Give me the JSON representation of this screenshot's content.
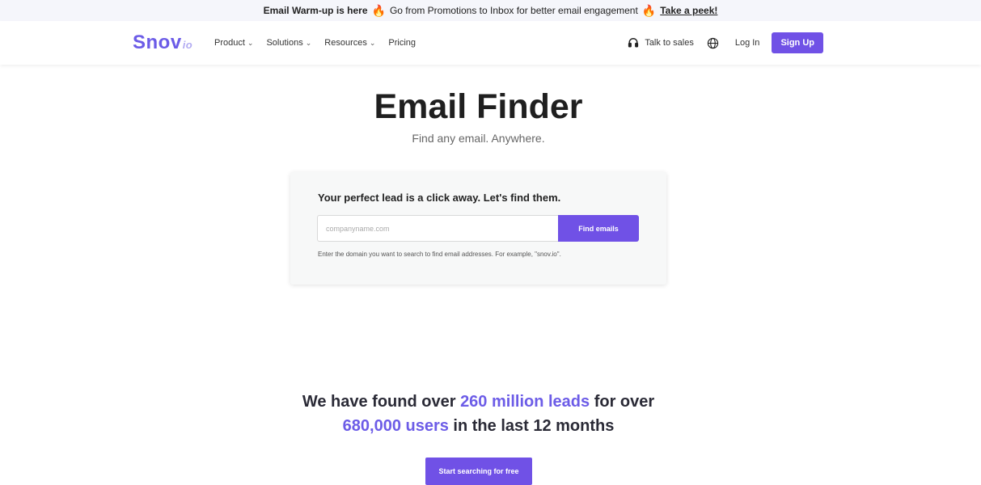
{
  "promo": {
    "headline": "Email Warm-up is here",
    "message": "Go from Promotions to Inbox for better email engagement",
    "link": "Take a peek!",
    "fire_icon": "🔥"
  },
  "nav": {
    "logo_main": "Snov",
    "logo_suffix": "io",
    "items": [
      {
        "label": "Product",
        "has_dropdown": true
      },
      {
        "label": "Solutions",
        "has_dropdown": true
      },
      {
        "label": "Resources",
        "has_dropdown": true
      },
      {
        "label": "Pricing",
        "has_dropdown": false
      }
    ],
    "talk_to_sales": "Talk to sales",
    "login": "Log In",
    "signup": "Sign Up",
    "chevron": "⌄"
  },
  "hero": {
    "title": "Email Finder",
    "subtitle": "Find any email. Anywhere."
  },
  "search": {
    "title": "Your perfect lead is a click away. Let's find them.",
    "placeholder": "companyname.com",
    "button": "Find emails",
    "hint": "Enter the domain you want to search to find email addresses. For example, \"snov.io\"."
  },
  "stats": {
    "part1": "We have found over ",
    "leads": "260 million leads",
    "part2": " for over",
    "users": "680,000 users",
    "part3": " in the last 12 months"
  },
  "cta": {
    "label": "Start searching for free"
  },
  "colors": {
    "accent": "#7051e6",
    "brand": "#6c5ce7",
    "promo_bg": "#f5f6fb"
  }
}
